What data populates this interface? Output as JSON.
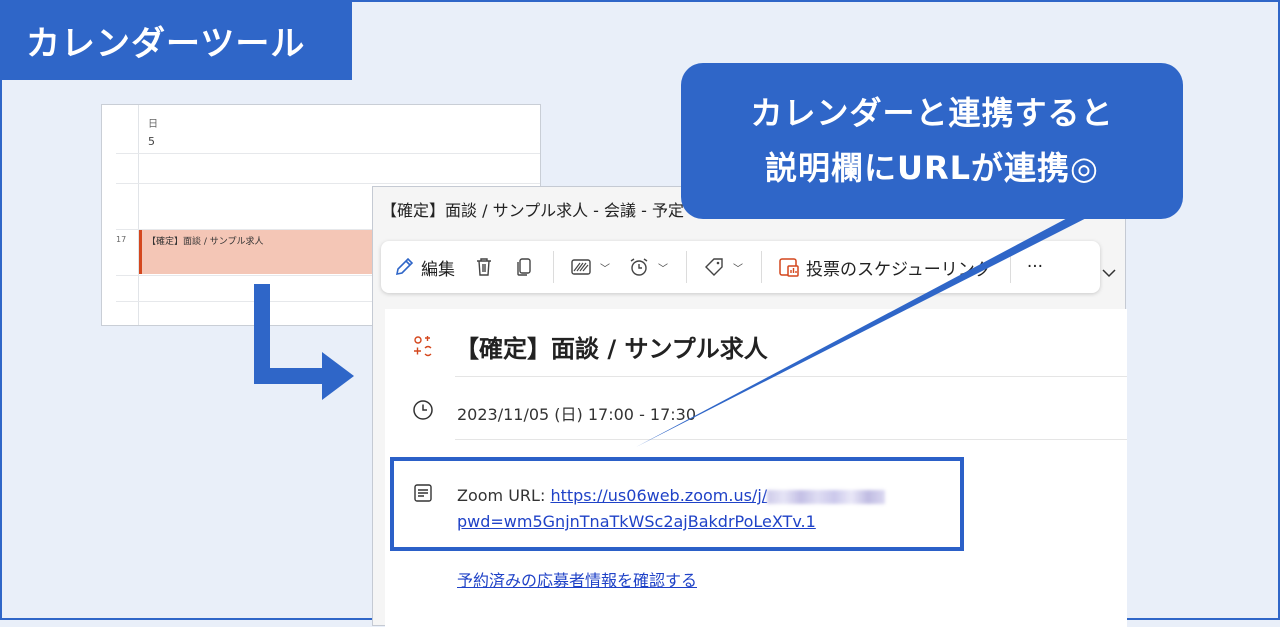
{
  "badge": {
    "text": "カレンダーツール"
  },
  "mini_calendar": {
    "day_of_week": "日",
    "day_number": "5",
    "hour_label": "17",
    "event_title": "【確定】面談 / サンプル求人"
  },
  "event_window": {
    "title_bar": "【確定】面談 / サンプル求人 - 会議 - 予定",
    "toolbar": {
      "edit_label": "編集",
      "scheduling_poll_label": "投票のスケジューリング",
      "more_label": "···"
    },
    "subject": "【確定】面談 / サンプル求人",
    "datetime": "2023/11/05 (日) 17:00 - 17:30",
    "notes": {
      "prefix": "Zoom URL: ",
      "url_line1": "https://us06web.zoom.us/j/",
      "url_line2": "pwd=wm5GnjnTnaTkWSc2ajBakdrPoLeXTv.1"
    },
    "applicant_link": "予約済みの応募者情報を確認する"
  },
  "callout": {
    "line1": "カレンダーと連携すると",
    "line2": "説明欄にURLが連携◎"
  },
  "colors": {
    "accent": "#2f66c8",
    "link": "#1f42c7",
    "event_fill": "#f4c6b6",
    "event_border": "#d4471d"
  }
}
